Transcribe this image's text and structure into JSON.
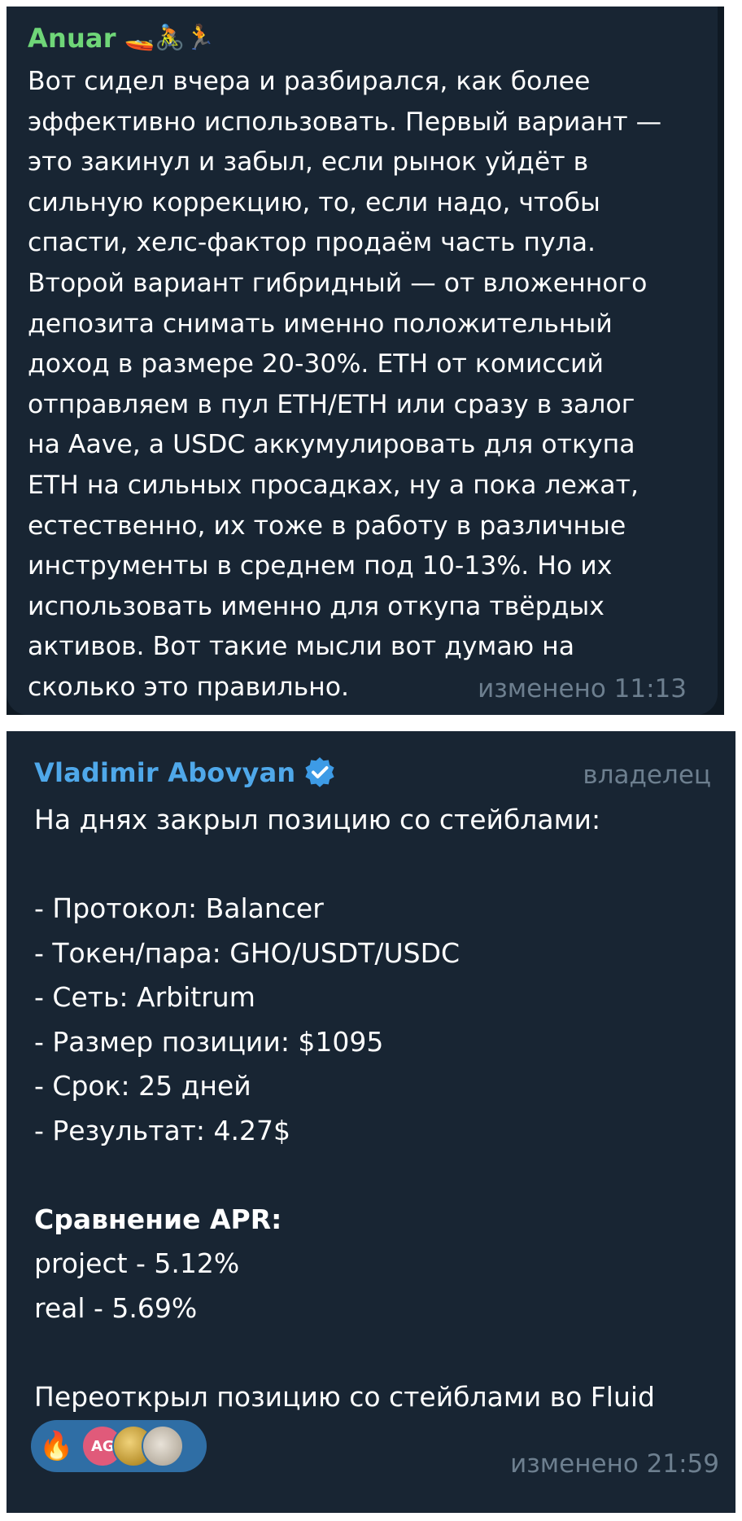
{
  "messages": [
    {
      "sender": "Anuar",
      "sender_color": "#6fd678",
      "emojis": "🚤🚴🏃",
      "text": "Вот сидел вчера и разбирался, как более\nэффективно использовать. Первый вариант —\nэто закинул и забыл, если рынок уйдёт в\nсильную коррекцию, то, если надо, чтобы\nспасти, хелс-фактор продаём часть пула.\nВторой вариант гибридный — от вложенного\nдепозита снимать именно положительный\nдоход в размере 20-30%. ETH от комиссий\nотправляем в пул ETH/ETH или сразу в залог\nна Aave, а USDC аккумулировать для откупа\nETH на сильных просадках, ну а пока лежат,\nестественно, их тоже в работу в различные\nинструменты в среднем под 10-13%. Но их\nиспользовать именно для откупа твёрдых\nактивов. Вот такие мысли вот думаю на\nсколько это правильно.",
      "meta": "изменено 11:13"
    },
    {
      "sender": "Vladimir Abovyan",
      "sender_color": "#4fa8ea",
      "verified_icon": "verified-badge-icon",
      "role": "владелец",
      "text_intro": "На днях закрыл позицию со стейблами:",
      "bullets": [
        "- Протокол: Balancer",
        "- Токен/пара: GHO/USDT/USDC",
        "- Сеть: Arbitrum",
        "- Размер позиции: $1095",
        "- Срок: 25 дней",
        "- Результат: 4.27$"
      ],
      "apr_heading": "Сравнение APR:",
      "apr_lines": [
        "project - 5.12%",
        "real - 5.69%"
      ],
      "footer": "Переоткрыл позицию со стейблами во Fluid",
      "reactions": {
        "emoji": "🔥",
        "avatar_initials": "AG",
        "accent": "#2f6ea5"
      },
      "meta": "изменено 21:59"
    }
  ]
}
